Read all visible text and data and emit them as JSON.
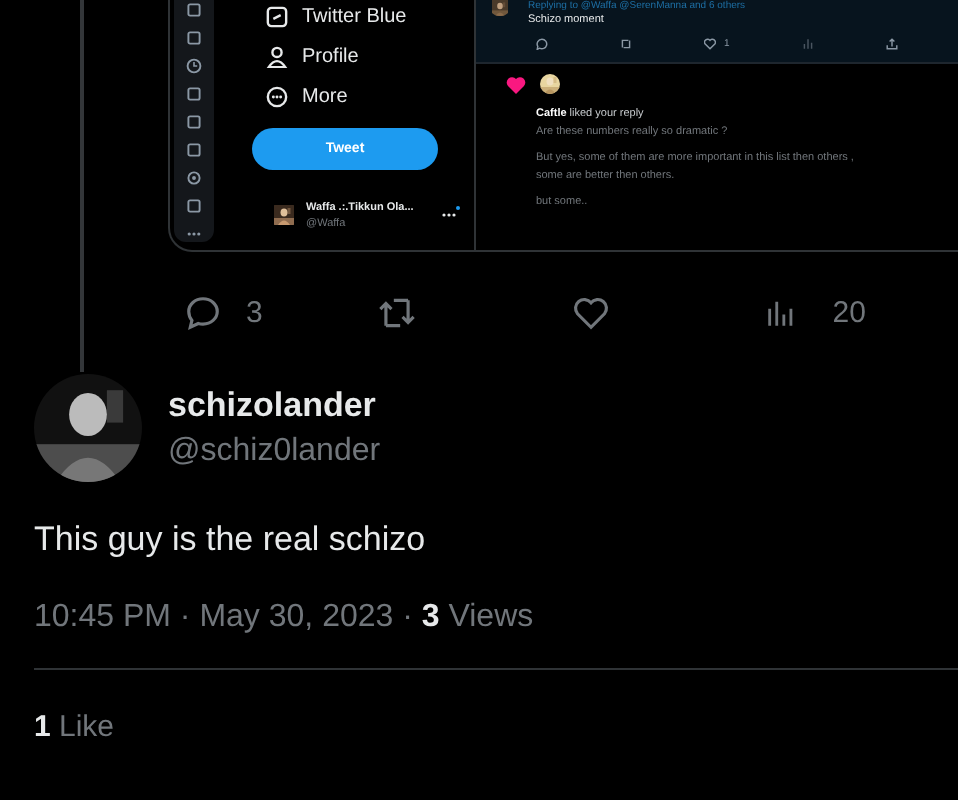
{
  "embedded_screenshot": {
    "nav": [
      {
        "label": "Twitter Blue"
      },
      {
        "label": "Profile"
      },
      {
        "label": "More"
      }
    ],
    "tweet_button": "Tweet",
    "account": {
      "name": "Waffa .:.Tikkun Ola...",
      "handle": "@Waffa"
    },
    "reply_tweet": {
      "replying_to": "Replying to @Waffa @SerenManna and 6 others",
      "text": "Schizo moment",
      "like_count": "1"
    },
    "notification": {
      "title": "**Caftle** liked your reply",
      "lines": [
        "Are these numbers really so dramatic ?",
        "But yes, some of them are more important in this list then others ,",
        "some are better then others.",
        "but some.."
      ]
    }
  },
  "tweet_actions": {
    "replies": "3",
    "views": "20"
  },
  "tweet": {
    "author": "schizolander",
    "handle": "@schiz0lander",
    "text": "This guy is the real schizo",
    "meta": "10:45 PM · May 30, 2023 · **3** Views"
  },
  "likes": "**1** Like"
}
